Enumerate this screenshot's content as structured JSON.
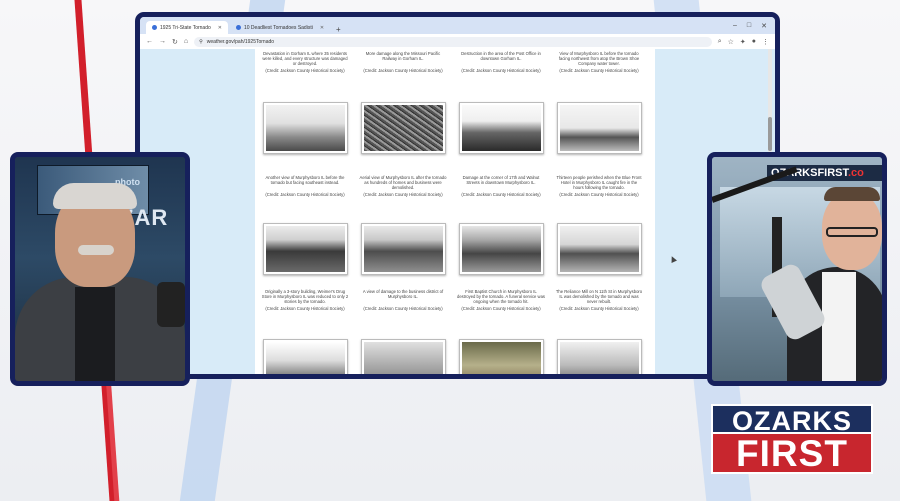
{
  "browser": {
    "tabs": [
      {
        "label": "1925 Tri-State Tornado",
        "active": true
      },
      {
        "label": "10 Deadliest Tornadoes Sadisti",
        "active": false
      }
    ],
    "address": "weather.gov/pah/1925Tornado"
  },
  "gallery": {
    "top_captions": [
      {
        "caption": "Devastation in Gorham IL where 35 residents were killed, and every structure was damaged or destroyed.",
        "credit": "(Credit: Jackson County Historical Society)"
      },
      {
        "caption": "More damage along the Missouri Pacific Railway in Gorham IL.",
        "credit": "(Credit: Jackson County Historical Society)"
      },
      {
        "caption": "Destruction in the area of the Post Office in downtown Gorham IL.",
        "credit": "(Credit: Jackson County Historical Society)"
      },
      {
        "caption": "View of Murphysboro IL before the tornado facing northwest from atop the Brown Shoe Company water tower.",
        "credit": "(Credit: Jackson County Historical Society)"
      }
    ],
    "row1": [
      {
        "caption": "Another view of Murphysboro IL before the tornado but facing southeast instead.",
        "credit": "(Credit: Jackson County Historical Society)"
      },
      {
        "caption": "Aerial view of Murphysboro IL after the tornado as hundreds of homes and business were demolished.",
        "credit": "(Credit: Jackson County Historical Society)"
      },
      {
        "caption": "Damage at the corner of 17th and Walnut Streets in downtown Murphysboro IL.",
        "credit": "(Credit: Jackson County Historical Society)"
      },
      {
        "caption": "Thirteen people perished when the Blue Front Hotel in Murphysboro IL caught fire in the hours following the tornado.",
        "credit": "(Credit: Jackson County Historical Society)"
      }
    ],
    "row2": [
      {
        "caption": "Originally a 3-story building, Weimer's Drug Store in Murphysboro IL was reduced to only 2 stories by the tornado.",
        "credit": "(Credit: Jackson County Historical Society)"
      },
      {
        "caption": "A view of damage to the business district of Murphysboro IL.",
        "credit": "(Credit: Jackson County Historical Society)"
      },
      {
        "caption": "First Baptist Church in Murphysboro IL destroyed by the tornado. A funeral service was ongoing when the tornado hit.",
        "credit": "(Credit: Jackson County Historical Society)"
      },
      {
        "caption": "The Reliance Mill on N 11th St in Murphysboro IL was demolished by the tornado and was never rebuilt.",
        "credit": "(Credit: Jackson County Historical Society)"
      }
    ]
  },
  "studio": {
    "left_screen_text": "photo",
    "left_wall_letters": "ZAR",
    "right_logo": "OZARKSFIRST",
    "right_logo_tail": ".co"
  },
  "brand": {
    "top": "OZARKS",
    "bottom": "FIRST",
    "colors": {
      "navy": "#1c2f5e",
      "red": "#c8262e"
    }
  }
}
